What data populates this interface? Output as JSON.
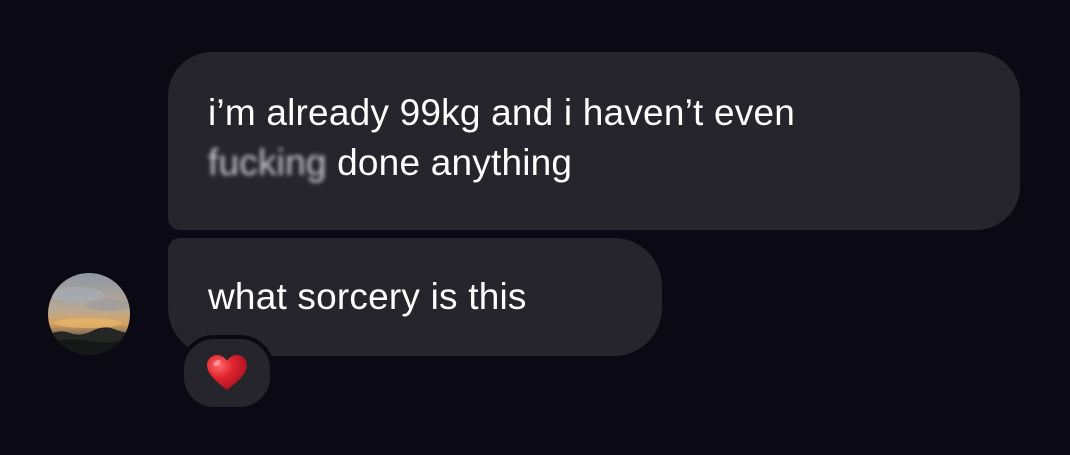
{
  "messages": [
    {
      "line1": "i’m already 99kg and i haven’t even",
      "line2_censored": "fucking",
      "line2_rest": " done anything"
    },
    {
      "text": "what sorcery is this"
    }
  ],
  "reaction": {
    "icon": "red-heart-icon",
    "color": "#e0242f"
  },
  "avatar": {
    "icon": "sunset-landscape-avatar"
  },
  "colors": {
    "background": "#0b0a14",
    "bubble": "#25252b",
    "text": "#ffffff"
  }
}
